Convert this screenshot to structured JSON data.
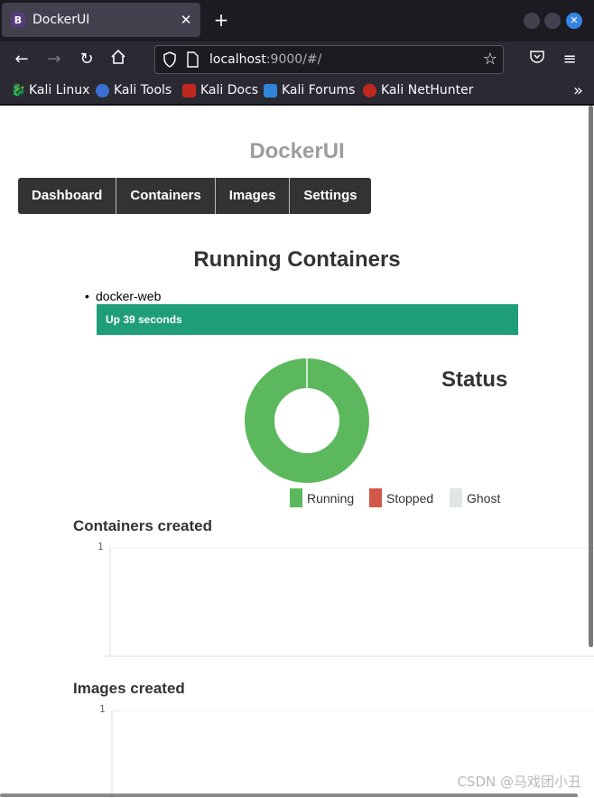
{
  "browser": {
    "tab_title": "DockerUI",
    "tab_favicon_letter": "B",
    "new_tab": "+",
    "url_host": "localhost",
    "url_rest": ":9000/#/",
    "bookmarks": [
      {
        "label": "Kali Linux",
        "icon": "kali-dragon-icon",
        "color": "#2a2a2a"
      },
      {
        "label": "Kali Tools",
        "icon": "kali-tools-icon",
        "color": "#3b6fd4"
      },
      {
        "label": "Kali Docs",
        "icon": "kali-docs-icon",
        "color": "#c0281e"
      },
      {
        "label": "Kali Forums",
        "icon": "kali-forums-icon",
        "color": "#2f86d9"
      },
      {
        "label": "Kali NetHunter",
        "icon": "kali-nethunter-icon",
        "color": "#c0281e"
      }
    ]
  },
  "page": {
    "brand": "DockerUI",
    "menu": [
      "Dashboard",
      "Containers",
      "Images",
      "Settings"
    ],
    "running_title": "Running Containers",
    "containers": [
      {
        "name": "docker-web",
        "status": "Up 39 seconds"
      }
    ],
    "status_title": "Status",
    "legend": [
      {
        "label": "Running",
        "color": "#5cb85c"
      },
      {
        "label": "Stopped",
        "color": "#d0584a"
      },
      {
        "label": "Ghost",
        "color": "#dfe6e5"
      }
    ],
    "containers_created_title": "Containers created",
    "images_created_title": "Images created",
    "axis_tick_1": "1",
    "axis_tick_2": "1"
  },
  "chart_data": [
    {
      "type": "pie",
      "title": "Status",
      "categories": [
        "Running",
        "Stopped",
        "Ghost"
      ],
      "values": [
        1,
        0,
        0
      ]
    }
  ],
  "watermark": "CSDN @马戏团小丑",
  "colors": {
    "running": "#5cb85c",
    "status_bar": "#1e9e78",
    "menu_bg": "#333333"
  }
}
